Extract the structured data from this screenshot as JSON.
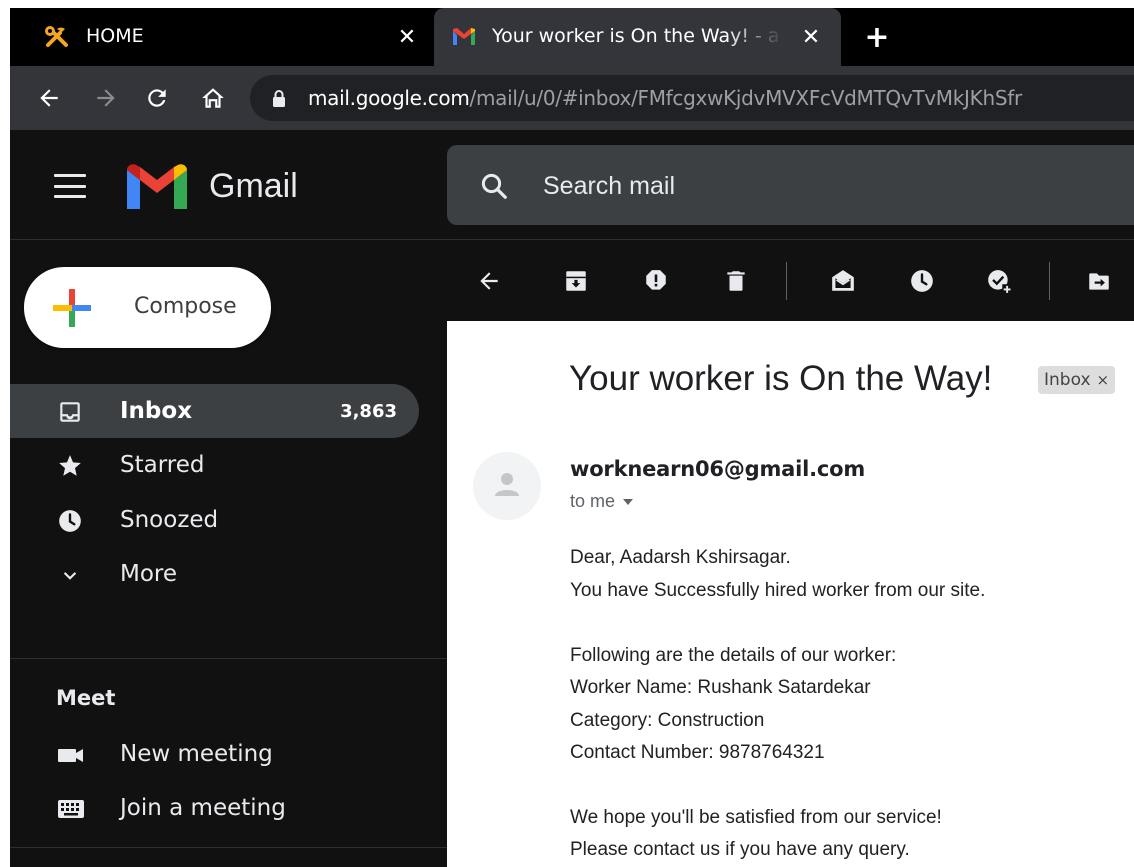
{
  "browser": {
    "tabs": [
      {
        "title": "HOME",
        "icon": "tools-icon",
        "close": "✕"
      },
      {
        "title": "Your worker is On the Way! - a",
        "icon": "gmail-icon",
        "close": "✕"
      }
    ],
    "new_tab": "+",
    "url": {
      "domain": "mail.google.com",
      "path": "/mail/u/0/#inbox/FMfcgxwKjdvMVXFcVdMTQvTvMkJKhSfr"
    }
  },
  "gmail": {
    "brand": "Gmail",
    "search_placeholder": "Search mail",
    "compose_label": "Compose",
    "nav": [
      {
        "label": "Inbox",
        "count": "3,863",
        "icon": "inbox-icon",
        "active": true
      },
      {
        "label": "Starred",
        "icon": "star-icon"
      },
      {
        "label": "Snoozed",
        "icon": "clock-icon"
      },
      {
        "label": "More",
        "icon": "chevron-down-icon"
      }
    ],
    "meet": {
      "title": "Meet",
      "items": [
        {
          "label": "New meeting",
          "icon": "video-icon"
        },
        {
          "label": "Join a meeting",
          "icon": "keyboard-icon"
        }
      ]
    },
    "toolbar_icons": [
      "back-arrow-icon",
      "archive-icon",
      "report-spam-icon",
      "delete-icon",
      "mark-unread-icon",
      "snooze-icon",
      "add-to-tasks-icon",
      "move-to-icon"
    ],
    "colors": {
      "red": "#ea4335",
      "blue": "#4285f4",
      "green": "#34a853",
      "yellow": "#fbbc04"
    }
  },
  "message": {
    "subject": "Your worker is On the Way!",
    "label_chip": "Inbox",
    "label_chip_close": "×",
    "sender": "worknearn06@gmail.com",
    "to": "to me",
    "body": [
      "Dear, Aadarsh Kshirsagar.",
      "You have Successfully hired worker from our site.",
      "",
      "Following are the details of our worker:",
      "Worker Name: Rushank Satardekar",
      "Category: Construction",
      "Contact Number: 9878764321",
      "",
      "We hope you'll be satisfied from our service!",
      "Please contact us if you have any query."
    ]
  }
}
